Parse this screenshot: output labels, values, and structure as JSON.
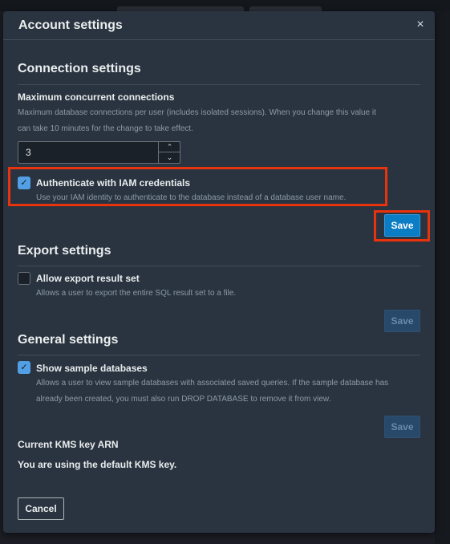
{
  "modal": {
    "title": "Account settings",
    "close_icon": "×"
  },
  "connection": {
    "heading": "Connection settings",
    "max_label": "Maximum concurrent connections",
    "max_desc_line1": "Maximum database connections per user (includes isolated sessions). When you change this value it",
    "max_desc_line2": "can take 10 minutes for the change to take effect.",
    "max_value": "3",
    "iam_label": "Authenticate with IAM credentials",
    "iam_desc": "Use your IAM identity to authenticate to the database instead of a database user name.",
    "iam_checked": true,
    "save_label": "Save"
  },
  "export": {
    "heading": "Export settings",
    "allow_label": "Allow export result set",
    "allow_desc": "Allows a user to export the entire SQL result set to a file.",
    "allow_checked": false,
    "save_label": "Save"
  },
  "general": {
    "heading": "General settings",
    "sample_label": "Show sample databases",
    "sample_desc_line1": "Allows a user to view sample databases with associated saved queries. If the sample database has",
    "sample_desc_line2": "already been created, you must also run DROP DATABASE to remove it from view.",
    "sample_checked": true,
    "save_label": "Save"
  },
  "kms": {
    "label": "Current KMS key ARN",
    "value": "You are using the default KMS key."
  },
  "footer": {
    "cancel_label": "Cancel"
  },
  "colors": {
    "modal_bg": "#2a3441",
    "primary": "#0b7dc5",
    "highlight": "#e8330c",
    "checkbox": "#539fe5"
  }
}
